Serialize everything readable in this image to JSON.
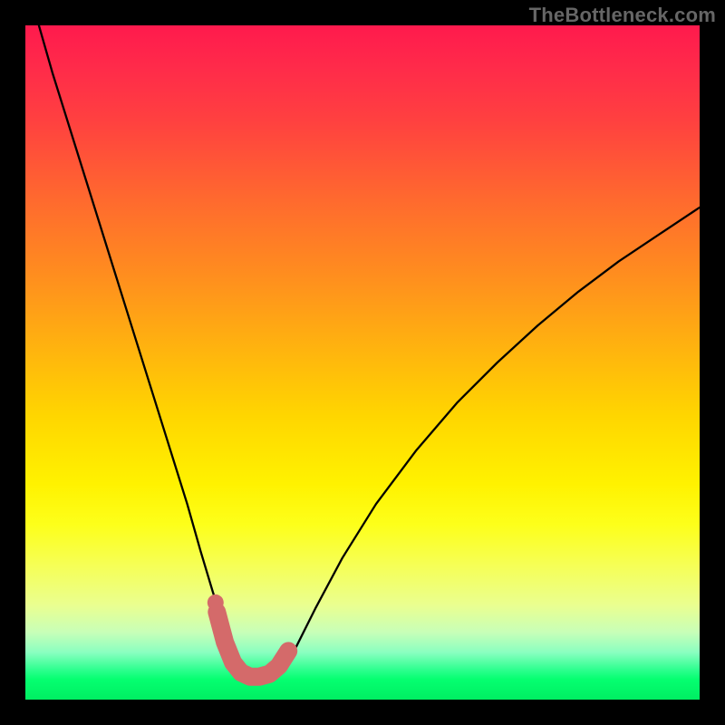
{
  "watermark": "TheBottleneck.com",
  "chart_data": {
    "type": "line",
    "title": "",
    "xlabel": "",
    "ylabel": "",
    "xlim": [
      0,
      1
    ],
    "ylim": [
      0,
      1
    ],
    "series": [
      {
        "name": "bottleneck-curve",
        "x": [
          0.02,
          0.04,
          0.065,
          0.09,
          0.115,
          0.14,
          0.165,
          0.19,
          0.215,
          0.24,
          0.26,
          0.278,
          0.294,
          0.307,
          0.32,
          0.333,
          0.347,
          0.362,
          0.38,
          0.4,
          0.43,
          0.47,
          0.52,
          0.58,
          0.64,
          0.7,
          0.76,
          0.82,
          0.88,
          0.94,
          1.0
        ],
        "y": [
          1.0,
          0.93,
          0.85,
          0.77,
          0.69,
          0.61,
          0.53,
          0.45,
          0.37,
          0.29,
          0.22,
          0.16,
          0.11,
          0.075,
          0.05,
          0.035,
          0.03,
          0.032,
          0.045,
          0.075,
          0.135,
          0.21,
          0.29,
          0.37,
          0.44,
          0.5,
          0.555,
          0.605,
          0.65,
          0.69,
          0.73
        ]
      }
    ],
    "markers": {
      "name": "highlight-band",
      "color": "#d46a6a",
      "x": [
        0.284,
        0.296,
        0.308,
        0.32,
        0.333,
        0.347,
        0.362,
        0.376,
        0.39
      ],
      "y": [
        0.13,
        0.085,
        0.055,
        0.04,
        0.034,
        0.034,
        0.038,
        0.05,
        0.072
      ]
    },
    "dot": {
      "x": 0.282,
      "y": 0.144,
      "color": "#d46a6a"
    }
  }
}
